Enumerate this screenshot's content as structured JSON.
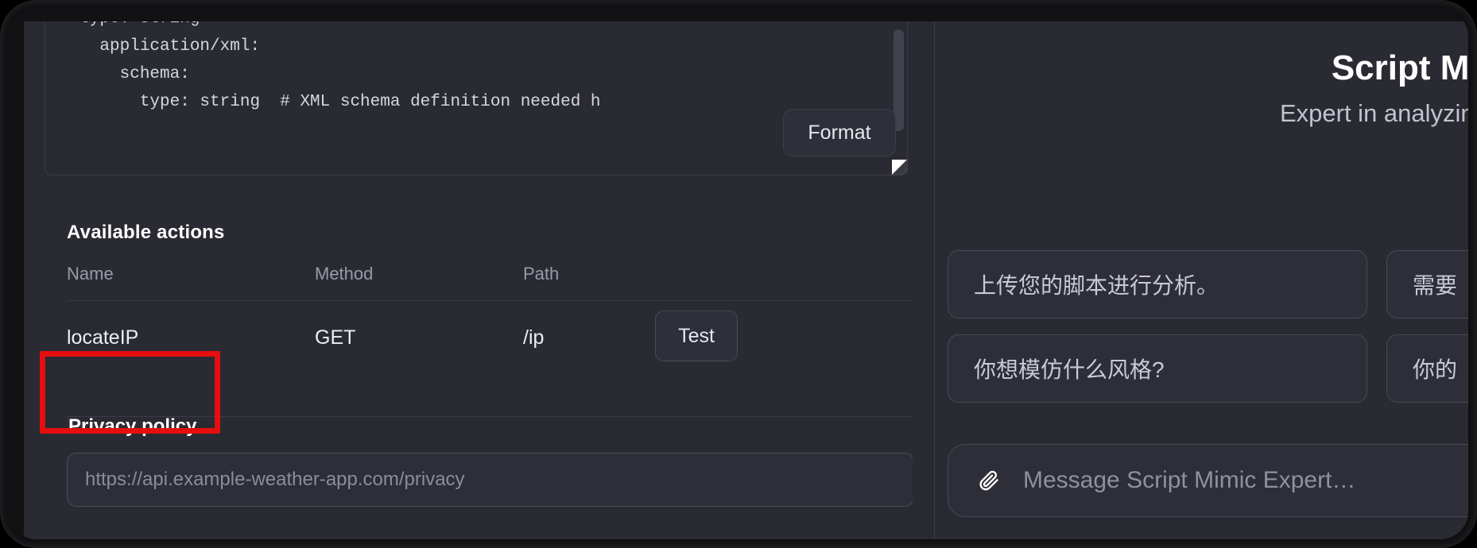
{
  "left_panel": {
    "code_editor": {
      "content": "  type: string\n    application/xml:\n      schema:\n        type: string  # XML schema definition needed h",
      "format_button": "Format",
      "resize_handle_name": "resize-handle"
    },
    "available_actions": {
      "heading": "Available actions",
      "columns": [
        "Name",
        "Method",
        "Path"
      ],
      "rows": [
        {
          "name": "locateIP",
          "method": "GET",
          "path": "/ip",
          "action_label": "Test"
        }
      ]
    },
    "privacy": {
      "label": "Privacy policy",
      "placeholder": "https://api.example-weather-app.com/privacy",
      "value": ""
    },
    "annotation": {
      "color": "#e60e0e",
      "target": "privacy-policy-label"
    }
  },
  "right_panel": {
    "title": "Script Mimic E",
    "subtitle": "Expert in analyzing & imitatin",
    "suggestions": [
      "上传您的脚本进行分析。",
      "需要",
      "你想模仿什么风格?",
      "你的"
    ],
    "composer": {
      "placeholder": "Message Script Mimic Expert…",
      "attach_icon": "paperclip-icon"
    }
  },
  "colors": {
    "background": "#2a2a33",
    "surface": "#2e2e38",
    "border": "#4a4a57",
    "text_primary": "#ffffff",
    "text_muted": "#9b9ba8",
    "annotation_red": "#e60e0e"
  }
}
